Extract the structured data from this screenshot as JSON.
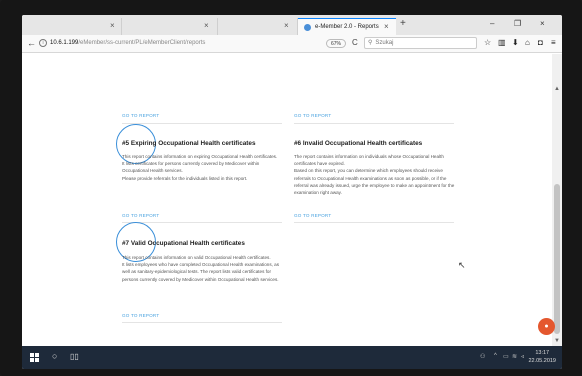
{
  "browser": {
    "tabs": [
      {
        "label": "",
        "close": "×"
      },
      {
        "label": "",
        "close": "×"
      },
      {
        "label": "",
        "close": "×"
      },
      {
        "label": "e-Member 2.0 - Reports",
        "close": "×",
        "active": true
      }
    ],
    "new_tab": "+",
    "window_controls": {
      "minimize": "–",
      "maximize": "❐",
      "close": "×"
    },
    "back": "←",
    "url_host": "10.6.1.199",
    "url_path": "/eMember/ss-current/PL/eMemberClient/reports",
    "zoom": "67%",
    "reload": "C",
    "search_placeholder": "Szukaj",
    "toolbar_icons": [
      "star-icon",
      "library-icon",
      "download-icon",
      "home-icon",
      "pocket-icon",
      "menu-icon"
    ]
  },
  "reports": {
    "top_links": [
      "GO TO REPORT",
      "GO TO REPORT"
    ],
    "card5": {
      "title": "#5 Expiring Occupational Health certificates",
      "desc": [
        "This report contains information on expiring Occupational Health certificates.",
        "It lists certificates for persons currently covered by Medicover within",
        "Occupational Health services.",
        "Please provide referrals for the individuals listed in this report."
      ],
      "link": "GO TO REPORT"
    },
    "card6": {
      "title": "#6 Invalid Occupational Health certificates",
      "desc": [
        "The report contains information on individuals whose Occupational Health",
        "certificates have expired.",
        "Based on this report, you can determine which employees should receive",
        "referrals to Occupational Health examinations as soon as possible, or if the",
        "referral was already issued, urge the employee to make an appointment for the",
        "examination right away."
      ],
      "link": "GO TO REPORT"
    },
    "card7": {
      "title": "#7 Valid Occupational Health certificates",
      "desc": [
        "This report contains information on valid Occupational Health certificates.",
        "It lists employees who have completed Occupational Health examinations, as",
        "well as sanitary-epidemiological tests. The report lists valid certificates for",
        "persons currently covered by Medicover within Occupational Health services."
      ],
      "link": "GO TO REPORT"
    }
  },
  "taskbar": {
    "clock_time": "13:17",
    "clock_date": "22.05.2019"
  },
  "colors": {
    "accent": "#3a8fd9",
    "fab": "#e4572e",
    "taskbar": "#1e2a3a"
  }
}
